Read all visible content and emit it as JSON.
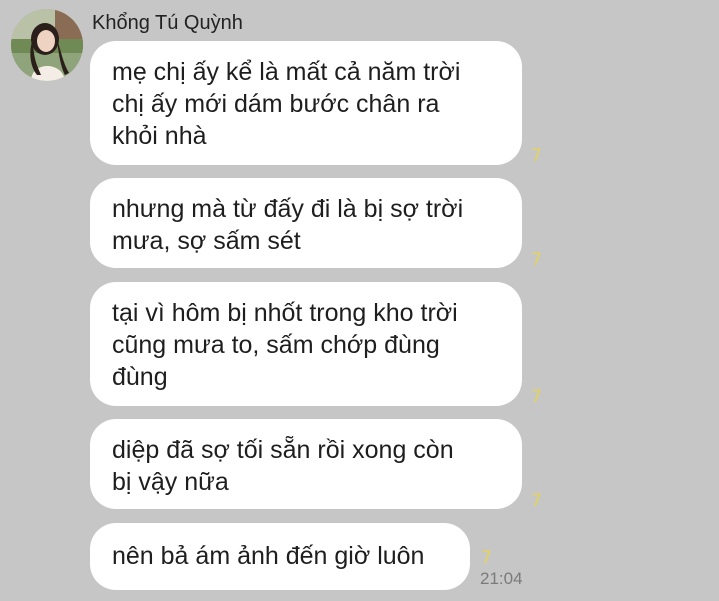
{
  "chat": {
    "sender": {
      "name": "Khổng Tú Quỳnh",
      "avatar_icon": "user-avatar-photo"
    },
    "messages": [
      {
        "text": "mẹ chị ấy kể là mất cả năm trời\nchị ấy mới dám bước chân ra\nkhỏi nhà",
        "read_count": "7"
      },
      {
        "text": "nhưng mà từ đấy đi là bị sợ trời\nmưa, sợ sấm sét",
        "read_count": "7"
      },
      {
        "text": "tại vì hôm bị nhốt trong kho trời\ncũng mưa to, sấm chớp đùng\nđùng",
        "read_count": "7"
      },
      {
        "text": "diệp đã sợ tối sẵn rồi xong còn\nbị vậy nữa",
        "read_count": "7"
      },
      {
        "text": "nên bả ám ảnh đến giờ luôn",
        "read_count": "7"
      }
    ],
    "last_timestamp": "21:04"
  },
  "colors": {
    "background": "#c6c6c6",
    "bubble": "#ffffff",
    "read_count": "#e3d35a",
    "timestamp": "#7a7a7a"
  }
}
